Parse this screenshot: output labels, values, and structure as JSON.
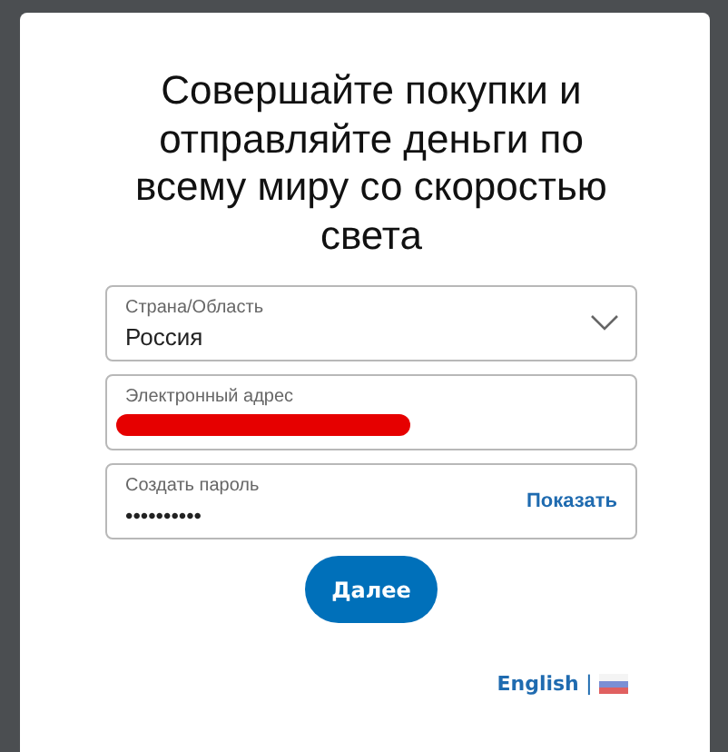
{
  "title": "Совершайте покупки и отправляйте деньги по всему миру со скоростью света",
  "fields": [
    {
      "kind": "select",
      "label": "Страна/Область",
      "value": "Россия"
    },
    {
      "kind": "redacted",
      "label": "Электронный адрес"
    },
    {
      "kind": "password",
      "label": "Создать пароль",
      "value": "••••••••••",
      "action": "Показать"
    }
  ],
  "button": "Далее",
  "language": {
    "link": "English",
    "separator": "|"
  }
}
